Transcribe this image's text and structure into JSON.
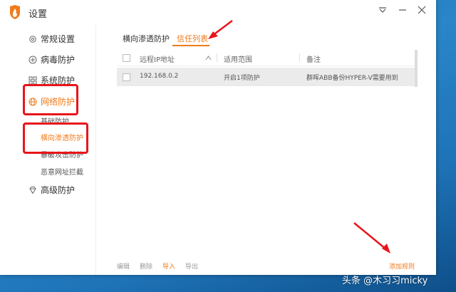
{
  "window": {
    "title": "设置"
  },
  "sidebar": {
    "items": [
      {
        "label": "常规设置",
        "icon": "gear-icon"
      },
      {
        "label": "病毒防护",
        "icon": "plus-circle-icon"
      },
      {
        "label": "系统防护",
        "icon": "grid-icon"
      },
      {
        "label": "网络防护",
        "icon": "globe-icon",
        "active": true
      },
      {
        "label": "高级防护",
        "icon": "diamond-icon"
      }
    ],
    "subitems": [
      {
        "label": "基础防护"
      },
      {
        "label": "横向渗透防护",
        "active": true
      },
      {
        "label": "暴破攻击防护"
      },
      {
        "label": "恶意网址拦截"
      }
    ]
  },
  "tabs": [
    {
      "label": "横向渗透防护"
    },
    {
      "label": "信任列表",
      "active": true
    }
  ],
  "table": {
    "headers": [
      "远程IP地址",
      "适用范围",
      "备注"
    ],
    "rows": [
      {
        "ip": "192.168.0.2",
        "scope": "开启1项防护",
        "note": "群晖ABB备份HYPER-V需要用到"
      }
    ]
  },
  "footer": {
    "edit": "编辑",
    "delete": "删除",
    "import": "导入",
    "export": "导出",
    "add_rule": "添加规则"
  },
  "watermark": "头条 @木习习micky",
  "colors": {
    "accent": "#f27b1a",
    "annotation": "#e8151b"
  }
}
